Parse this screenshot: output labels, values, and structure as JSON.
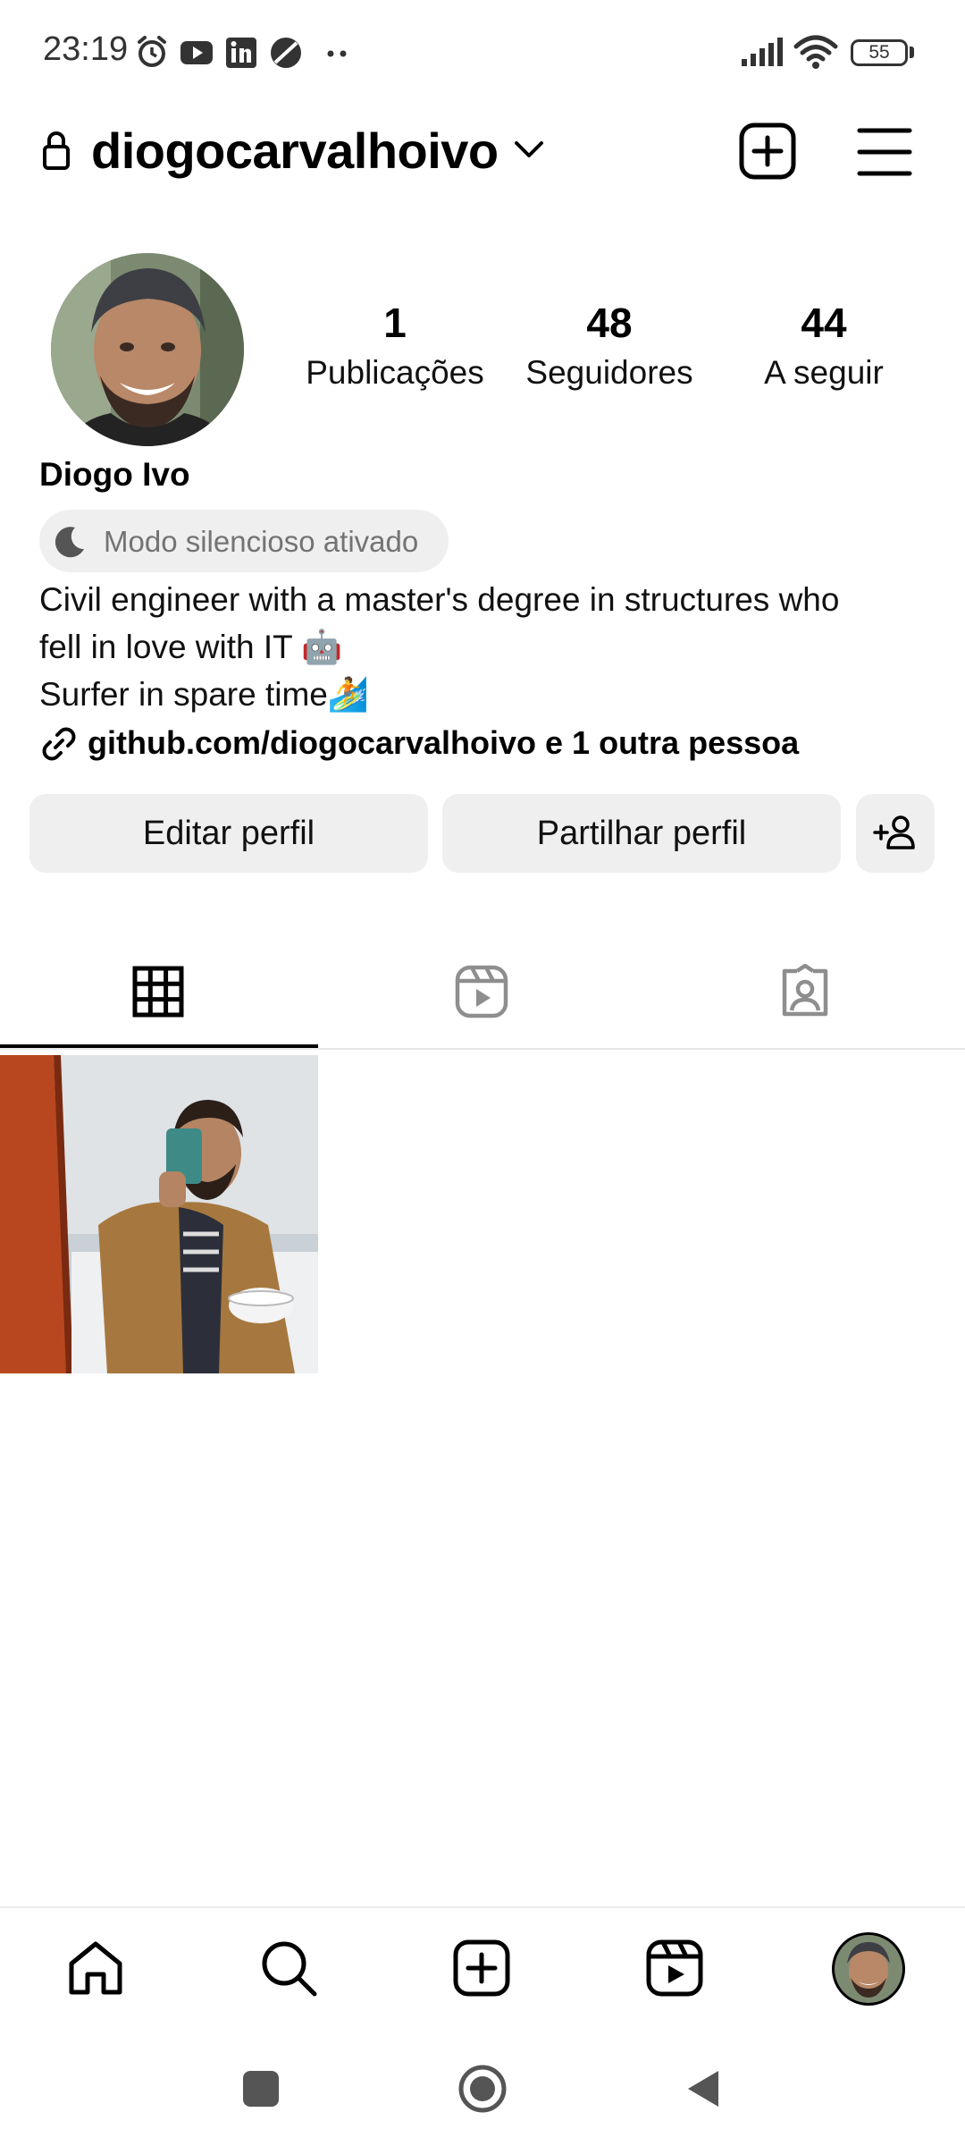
{
  "status_bar": {
    "time": "23:19",
    "left_icons": [
      "alarm-icon",
      "youtube-icon",
      "linkedin-icon",
      "app-icon",
      "more-dots-icon"
    ],
    "right_icons": [
      "signal-icon",
      "wifi-icon"
    ],
    "battery": "55"
  },
  "header": {
    "username": "diogocarvalhoivo",
    "icons": [
      "lock-icon",
      "chevron-down-icon",
      "new-post-icon",
      "menu-icon"
    ]
  },
  "profile": {
    "display_name": "Diogo Ivo",
    "stats": [
      {
        "value": "1",
        "label": "Publicações"
      },
      {
        "value": "48",
        "label": "Seguidores"
      },
      {
        "value": "44",
        "label": "A seguir"
      }
    ],
    "quiet_mode": "Modo silencioso ativado",
    "bio": [
      "Civil engineer with a master's degree in structures who",
      "fell in love with IT 🤖",
      "Surfer in spare time🏄"
    ],
    "link": "github.com/diogocarvalhoivo e 1 outra pessoa"
  },
  "actions": {
    "edit": "Editar perfil",
    "share": "Partilhar perfil"
  },
  "tabs": [
    "grid-icon",
    "reels-icon",
    "tagged-icon"
  ],
  "bottom_nav": [
    "home-icon",
    "search-icon",
    "create-icon",
    "reels-icon",
    "profile-avatar"
  ],
  "system_nav": [
    "recents-button",
    "home-button",
    "back-button"
  ]
}
